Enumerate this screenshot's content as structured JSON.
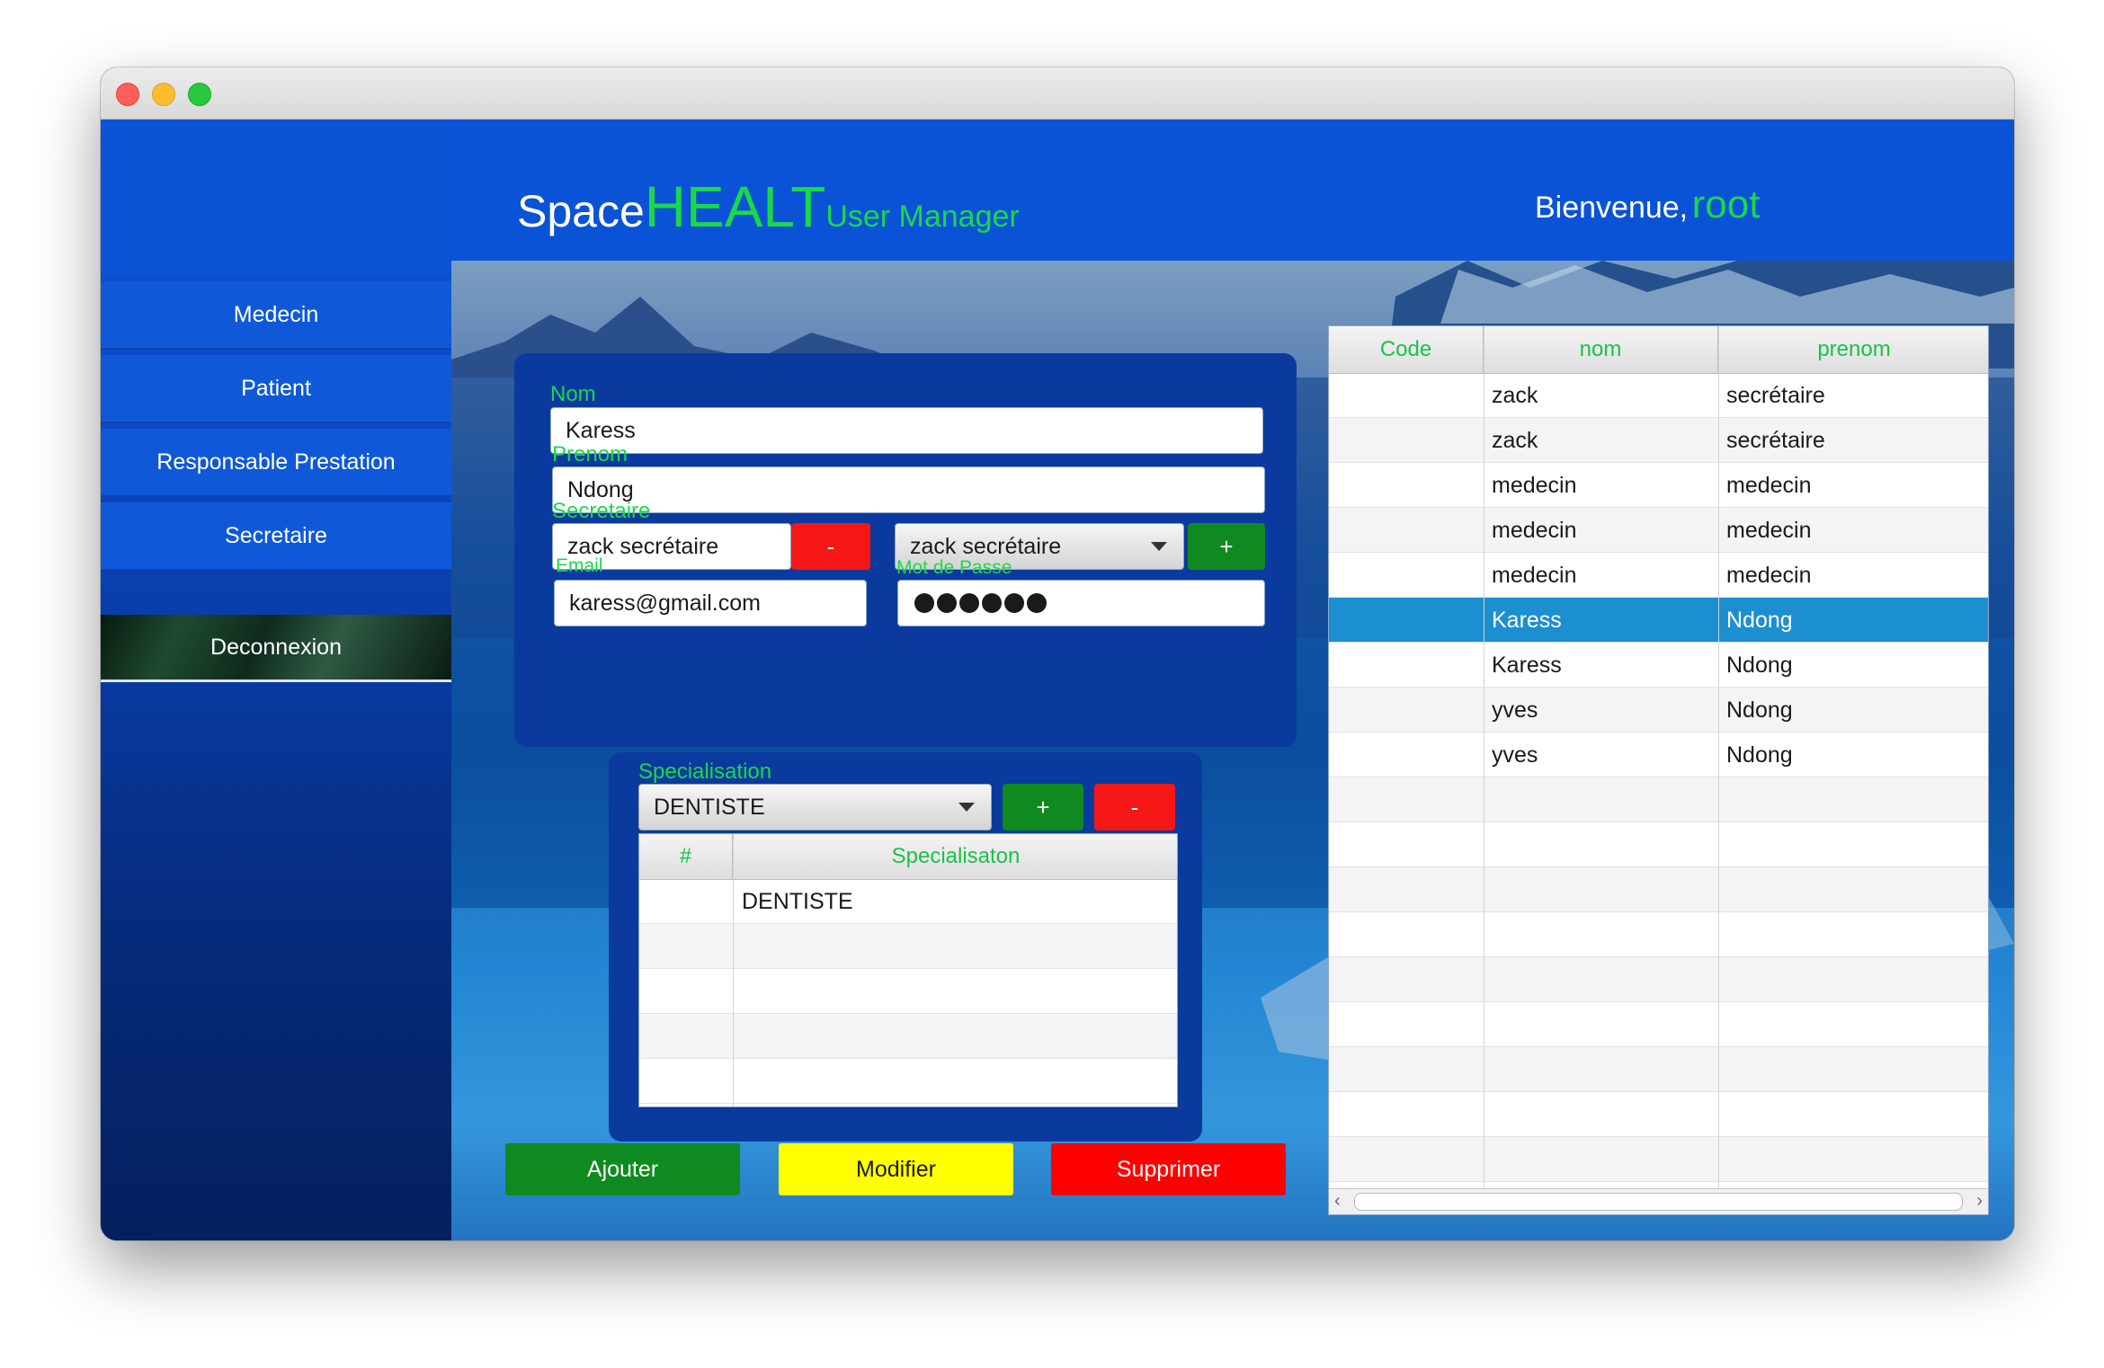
{
  "brand": {
    "part1": "Space",
    "part2": "HEALT",
    "part3": "User Manager"
  },
  "welcome": {
    "label": "Bienvenue,",
    "user": "root"
  },
  "sidebar": {
    "items": [
      {
        "label": "Medecin"
      },
      {
        "label": "Patient"
      },
      {
        "label": "Responsable Prestation"
      },
      {
        "label": "Secretaire"
      }
    ],
    "logout": "Deconnexion"
  },
  "form": {
    "nom_label": "Nom",
    "nom_value": "Karess",
    "prenom_label": "Prenom",
    "prenom_value": "Ndong",
    "secretaire_label": "Secretaire",
    "secretaire_value": "zack secrétaire",
    "secretaire_remove": "-",
    "secretaire_select": "zack secrétaire",
    "secretaire_add": "+",
    "email_label": "Email",
    "email_value": "karess@gmail.com",
    "password_label": "Mot de Passe"
  },
  "specialisation": {
    "label": "Specialisation",
    "select_value": "DENTISTE",
    "add": "+",
    "remove": "-",
    "columns": [
      "#",
      "Specialisaton"
    ],
    "rows": [
      {
        "num": "",
        "name": "DENTISTE"
      }
    ]
  },
  "users_table": {
    "columns": [
      "Code",
      "nom",
      "prenom"
    ],
    "rows": [
      {
        "code": "",
        "nom": "zack",
        "prenom": "secrétaire"
      },
      {
        "code": "",
        "nom": "zack",
        "prenom": "secrétaire"
      },
      {
        "code": "",
        "nom": "medecin",
        "prenom": "medecin"
      },
      {
        "code": "",
        "nom": "medecin",
        "prenom": "medecin"
      },
      {
        "code": "",
        "nom": "medecin",
        "prenom": "medecin"
      },
      {
        "code": "",
        "nom": "Karess",
        "prenom": "Ndong"
      },
      {
        "code": "",
        "nom": "Karess",
        "prenom": "Ndong"
      },
      {
        "code": "",
        "nom": "yves",
        "prenom": "Ndong"
      },
      {
        "code": "",
        "nom": "yves",
        "prenom": "Ndong"
      }
    ],
    "selected_index": 5
  },
  "actions": {
    "add": "Ajouter",
    "modify": "Modifier",
    "delete": "Supprimer"
  },
  "colors": {
    "accent_green": "#19d94a",
    "header_blue": "#0b53d6",
    "selection_blue": "#1c8fd0",
    "add_green": "#0f8a20",
    "modify_yellow": "#ffff00",
    "delete_red": "#ff0000"
  }
}
